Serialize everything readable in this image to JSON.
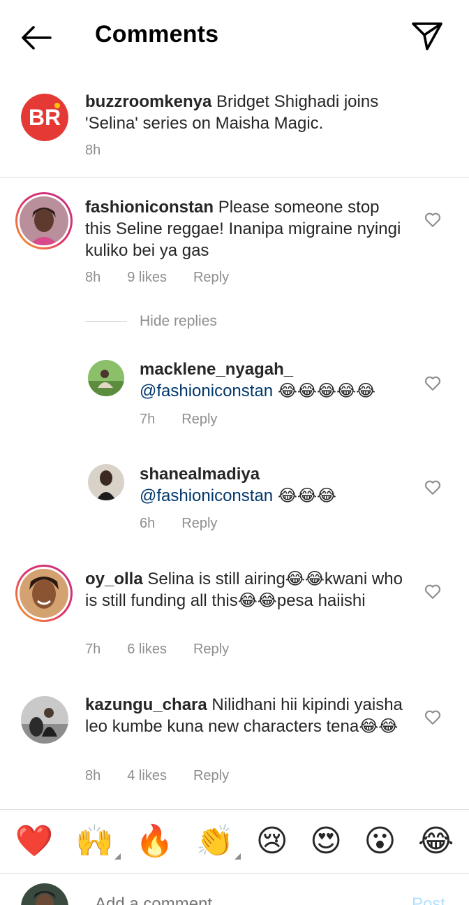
{
  "header": {
    "title": "Comments"
  },
  "caption": {
    "username": "buzzroomkenya",
    "text": " Bridget Shighadi joins 'Selina' series on Maisha Magic.",
    "time": "8h"
  },
  "comments": [
    {
      "username": "fashioniconstan",
      "text": " Please someone stop this Seline reggae! Inanipa migraine nyingi kuliko bei ya gas",
      "time": "8h",
      "likes": "9 likes",
      "reply": "Reply"
    },
    {
      "username": "oy_olla",
      "text": " Selina is still airing😂😂kwani who is still funding all this😂😂pesa haiishi",
      "time": "7h",
      "likes": "6 likes",
      "reply": "Reply"
    },
    {
      "username": "kazungu_chara",
      "text": " Nilidhani hii kipindi yaisha leo kumbe kuna new characters tena😂😂",
      "time": "8h",
      "likes": "4 likes",
      "reply": "Reply"
    }
  ],
  "hide_replies": "Hide replies",
  "replies": [
    {
      "username": "macklene_nyagah_",
      "mention": "@fashioniconstan",
      "emojis": " 😂😂😂😂😂",
      "time": "7h",
      "reply": "Reply"
    },
    {
      "username": "shanealmadiya",
      "mention": "@fashioniconstan",
      "emojis": " 😂😂😂",
      "time": "6h",
      "reply": "Reply"
    }
  ],
  "emoji_bar": [
    "❤️",
    "🙌",
    "🔥",
    "👏",
    "😢",
    "😍",
    "😮",
    "😂"
  ],
  "add_comment": {
    "placeholder": "Add a comment...",
    "post": "Post"
  },
  "colors": {
    "mention": "#00376b",
    "meta": "#8e8e8e",
    "post": "#b2dffc",
    "brand_red": "#e53935"
  }
}
